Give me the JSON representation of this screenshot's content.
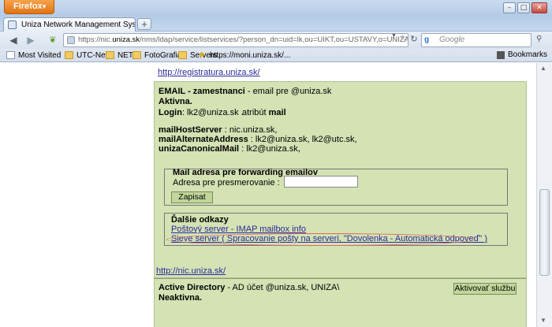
{
  "browser": {
    "menu_label": "Firefox",
    "window_buttons": {
      "minimize": "–",
      "maximize": "□",
      "close": "✕"
    },
    "tab_title": "Uniza Network Management System",
    "new_tab_label": "+",
    "url_prefix": "https://nic.",
    "url_host": "uniza.sk",
    "url_rest": "/nms/ldap/service/listservices/?person_dn=uid=lk,ou=UIKT,ou=USTAVY,o=UNIZA,",
    "search_placeholder": "Google",
    "search_engine_icon": "g",
    "bookmarks": [
      {
        "label": "Most Visited",
        "icon": "folder"
      },
      {
        "label": "UTC-Net",
        "icon": "folder"
      },
      {
        "label": "NET",
        "icon": "folder"
      },
      {
        "label": "FotoGrafia",
        "icon": "folder"
      },
      {
        "label": "Servers",
        "icon": "folder"
      },
      {
        "label": "https://moni.uniza.sk/...",
        "icon": "star"
      }
    ],
    "bookmarks_menu": "Bookmarks"
  },
  "page": {
    "registratura_link": "http://registratura.uniza.sk/",
    "email": {
      "title": "EMAIL - zamestnanci",
      "title_rest": " - email pre @uniza.sk",
      "status": "Aktivna.",
      "login_label": "Login",
      "login_value": ": lk2@uniza.sk .",
      "attr_label": "atribút",
      "attr_value": "mail",
      "mail_host_label": "mailHostServer",
      "mail_host_value": " : nic.uniza.sk,",
      "alt_addr_label": "mailAlternateAddress",
      "alt_addr_value": " : lk2@uniza.sk, lk2@utc.sk,",
      "canonical_label": "unizaCanonicalMail",
      "canonical_value": " : lk2@uniza.sk,",
      "forward_title": "Mail adresa pre forwarding emailov",
      "forward_label": "Adresa pre presmerovanie :",
      "forward_value": "",
      "save_button": "Zapisat",
      "more_links_title": "Ďalšie odkazy",
      "link_postovy": "Poštový server - IMAP mailbox info",
      "link_sieve": "Sieve server ( Spracovanie pošty na serveri, \"Dovolenka - Automatická odpoveď\" )",
      "nic_link": "http://nic.uniza.sk/"
    },
    "ad": {
      "title": "Active Directory",
      "title_rest": " - AD účet @uniza.sk, UNIZA\\",
      "status": "Neaktivna.",
      "activate_button": "Aktivovať službu"
    }
  }
}
